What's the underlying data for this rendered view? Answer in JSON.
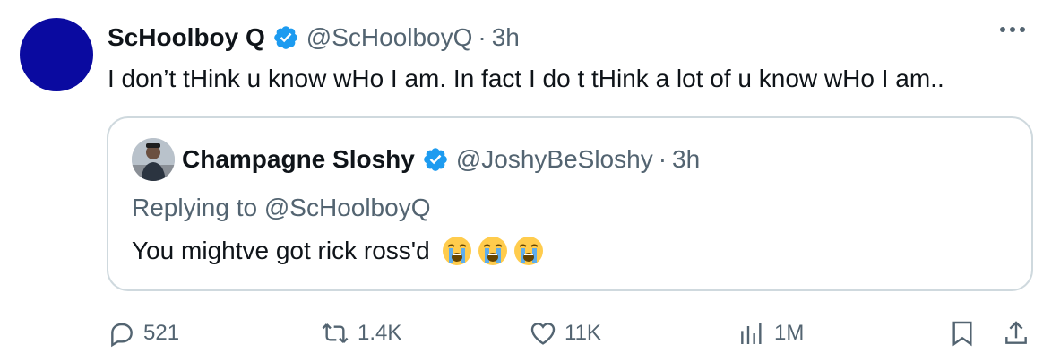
{
  "tweet": {
    "author_name": "ScHoolboy Q",
    "author_handle": "@ScHoolboyQ",
    "separator": "·",
    "time": "3h",
    "text": "I don’t tHink u know wHo I am. In fact I do t tHink a lot of u know wHo I am..",
    "avatar_color": "#0a0aa0"
  },
  "quote": {
    "author_name": "Champagne Sloshy",
    "author_handle": "@JoshyBeSloshy",
    "separator": "·",
    "time": "3h",
    "replying_label": "Replying to",
    "replying_handle": "@ScHoolboyQ",
    "text": "You mightve got rick ross'd",
    "emojis": [
      "loudly-crying-face",
      "loudly-crying-face",
      "loudly-crying-face"
    ]
  },
  "actions": {
    "replies": "521",
    "reposts": "1.4K",
    "likes": "11K",
    "views": "1M"
  },
  "colors": {
    "verified": "#1d9bf0",
    "secondary_text": "#536471",
    "border": "#cfd9de"
  },
  "icons": [
    "verified-badge-icon",
    "more-icon",
    "reply-icon",
    "repost-icon",
    "like-icon",
    "views-icon",
    "bookmark-icon",
    "share-icon"
  ]
}
